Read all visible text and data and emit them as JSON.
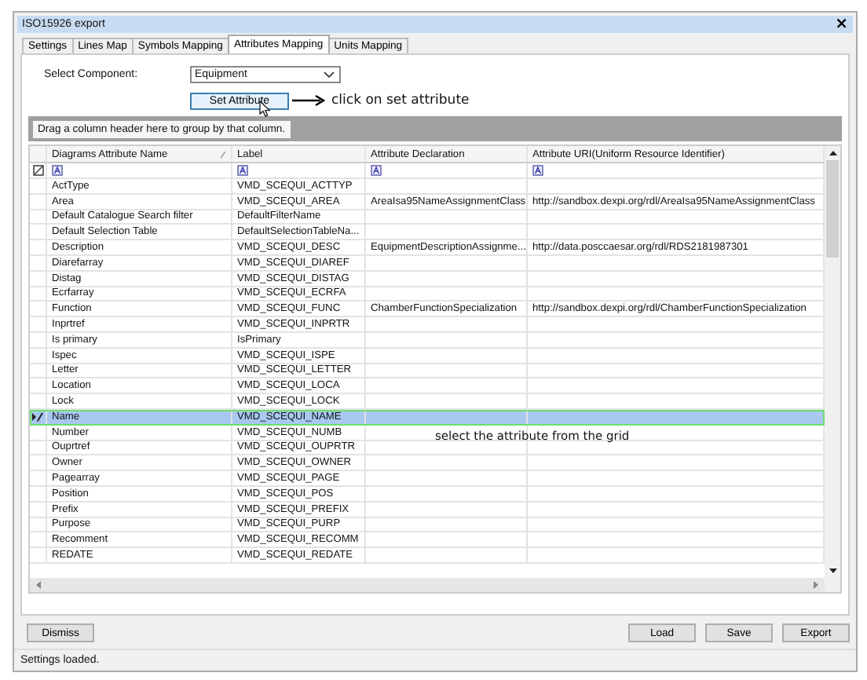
{
  "window": {
    "title": "ISO15926 export",
    "close": "×"
  },
  "tabs": [
    {
      "label": "Settings",
      "selected": false
    },
    {
      "label": "Lines Map",
      "selected": false
    },
    {
      "label": "Symbols Mapping",
      "selected": false
    },
    {
      "label": "Attributes Mapping",
      "selected": true
    },
    {
      "label": "Units Mapping",
      "selected": false
    }
  ],
  "select_component": {
    "label": "Select Component:",
    "value": "Equipment"
  },
  "set_attribute_button": "Set Attribute",
  "annotations": [
    {
      "kind": "arrow",
      "text": "click on set attribute"
    },
    {
      "kind": "plain",
      "text": "select the attribute from the grid"
    }
  ],
  "group_panel": "Drag a column header here to group by that column.",
  "table": {
    "columns": [
      "Diagrams Attribute Name",
      "Label",
      "Attribute Declaration",
      "Attribute URI(Uniform Resource Identifier)"
    ],
    "rows": [
      {
        "name": "ActType",
        "label": "VMD_SCEQUI_ACTTYP",
        "declaration": "",
        "uri": "",
        "selected": false
      },
      {
        "name": "Area",
        "label": "VMD_SCEQUI_AREA",
        "declaration": "AreaIsa95NameAssignmentClass",
        "uri": "http://sandbox.dexpi.org/rdl/AreaIsa95NameAssignmentClass",
        "selected": false
      },
      {
        "name": "Default Catalogue Search filter",
        "label": "DefaultFilterName",
        "declaration": "",
        "uri": "",
        "selected": false
      },
      {
        "name": "Default Selection Table",
        "label": "DefaultSelectionTableNa...",
        "declaration": "",
        "uri": "",
        "selected": false
      },
      {
        "name": "Description",
        "label": "VMD_SCEQUI_DESC",
        "declaration": "EquipmentDescriptionAssignme...",
        "uri": "http://data.posccaesar.org/rdl/RDS2181987301",
        "selected": false
      },
      {
        "name": "Diarefarray",
        "label": "VMD_SCEQUI_DIAREF",
        "declaration": "",
        "uri": "",
        "selected": false
      },
      {
        "name": "Distag",
        "label": "VMD_SCEQUI_DISTAG",
        "declaration": "",
        "uri": "",
        "selected": false
      },
      {
        "name": "Ecrfarray",
        "label": "VMD_SCEQUI_ECRFA",
        "declaration": "",
        "uri": "",
        "selected": false
      },
      {
        "name": "Function",
        "label": "VMD_SCEQUI_FUNC",
        "declaration": "ChamberFunctionSpecialization",
        "uri": "http://sandbox.dexpi.org/rdl/ChamberFunctionSpecialization",
        "selected": false
      },
      {
        "name": "Inprtref",
        "label": "VMD_SCEQUI_INPRTR",
        "declaration": "",
        "uri": "",
        "selected": false
      },
      {
        "name": "Is primary",
        "label": "IsPrimary",
        "declaration": "",
        "uri": "",
        "selected": false
      },
      {
        "name": "Ispec",
        "label": "VMD_SCEQUI_ISPE",
        "declaration": "",
        "uri": "",
        "selected": false
      },
      {
        "name": "Letter",
        "label": "VMD_SCEQUI_LETTER",
        "declaration": "",
        "uri": "",
        "selected": false
      },
      {
        "name": "Location",
        "label": "VMD_SCEQUI_LOCA",
        "declaration": "",
        "uri": "",
        "selected": false
      },
      {
        "name": "Lock",
        "label": "VMD_SCEQUI_LOCK",
        "declaration": "",
        "uri": "",
        "selected": false
      },
      {
        "name": "Name",
        "label": "VMD_SCEQUI_NAME",
        "declaration": "",
        "uri": "",
        "selected": true
      },
      {
        "name": "Number",
        "label": "VMD_SCEQUI_NUMB",
        "declaration": "",
        "uri": "",
        "selected": false
      },
      {
        "name": "Ouprtref",
        "label": "VMD_SCEQUI_OUPRTR",
        "declaration": "",
        "uri": "",
        "selected": false
      },
      {
        "name": "Owner",
        "label": "VMD_SCEQUI_OWNER",
        "declaration": "",
        "uri": "",
        "selected": false
      },
      {
        "name": "Pagearray",
        "label": "VMD_SCEQUI_PAGE",
        "declaration": "",
        "uri": "",
        "selected": false
      },
      {
        "name": "Position",
        "label": "VMD_SCEQUI_POS",
        "declaration": "",
        "uri": "",
        "selected": false
      },
      {
        "name": "Prefix",
        "label": "VMD_SCEQUI_PREFIX",
        "declaration": "",
        "uri": "",
        "selected": false
      },
      {
        "name": "Purpose",
        "label": "VMD_SCEQUI_PURP",
        "declaration": "",
        "uri": "",
        "selected": false
      },
      {
        "name": "Recomment",
        "label": "VMD_SCEQUI_RECOMM",
        "declaration": "",
        "uri": "",
        "selected": false
      },
      {
        "name": "REDATE",
        "label": "VMD_SCEQUI_REDATE",
        "declaration": "",
        "uri": "",
        "selected": false
      }
    ]
  },
  "buttons": {
    "dismiss": "Dismiss",
    "actions": [
      "Load",
      "Save",
      "Export"
    ]
  },
  "status_bar": "Settings loaded."
}
